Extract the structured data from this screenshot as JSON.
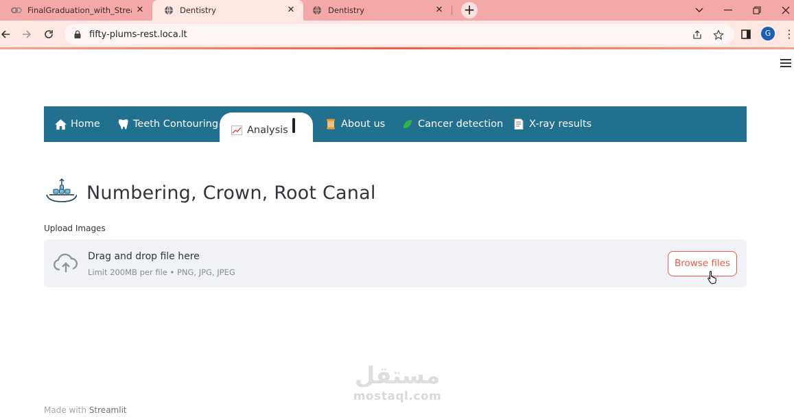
{
  "browser": {
    "tabs": [
      {
        "title": "FinalGraduation_with_Streamlit",
        "icon": "colab-icon",
        "active": false
      },
      {
        "title": "Dentistry",
        "icon": "globe-icon",
        "active": true
      },
      {
        "title": "Dentistry",
        "icon": "globe-icon",
        "active": false
      }
    ],
    "new_tab_label": "+",
    "url": "fifty-plums-rest.loca.lt",
    "profile_initial": "G"
  },
  "menu": {
    "items": [
      {
        "label": "Home",
        "icon": "home-icon"
      },
      {
        "label": "Teeth Contouring",
        "icon": "tooth-icon"
      },
      {
        "label": "Analysis",
        "icon": "chart-icon"
      },
      {
        "label": "About us",
        "icon": "scroll-icon"
      },
      {
        "label": "Cancer detection",
        "icon": "leaf-icon"
      },
      {
        "label": "X-ray results",
        "icon": "document-icon"
      }
    ],
    "active_index": 2,
    "color": "#21708f"
  },
  "page": {
    "title": "Numbering, Crown, Root Canal",
    "upload_label": "Upload Images",
    "dropzone": {
      "main_text": "Drag and drop file here",
      "sub_text": "Limit 200MB per file • PNG, JPG, JPEG",
      "button_label": "Browse files"
    },
    "watermark": {
      "arabic": "مستقل",
      "latin": "mostaql.com"
    },
    "footer": {
      "prefix": "Made with",
      "brand": "Streamlit"
    }
  },
  "colors": {
    "accent": "#e85a46",
    "tabbar": "#f5a8a8",
    "toolbar": "#ffe7e3"
  }
}
